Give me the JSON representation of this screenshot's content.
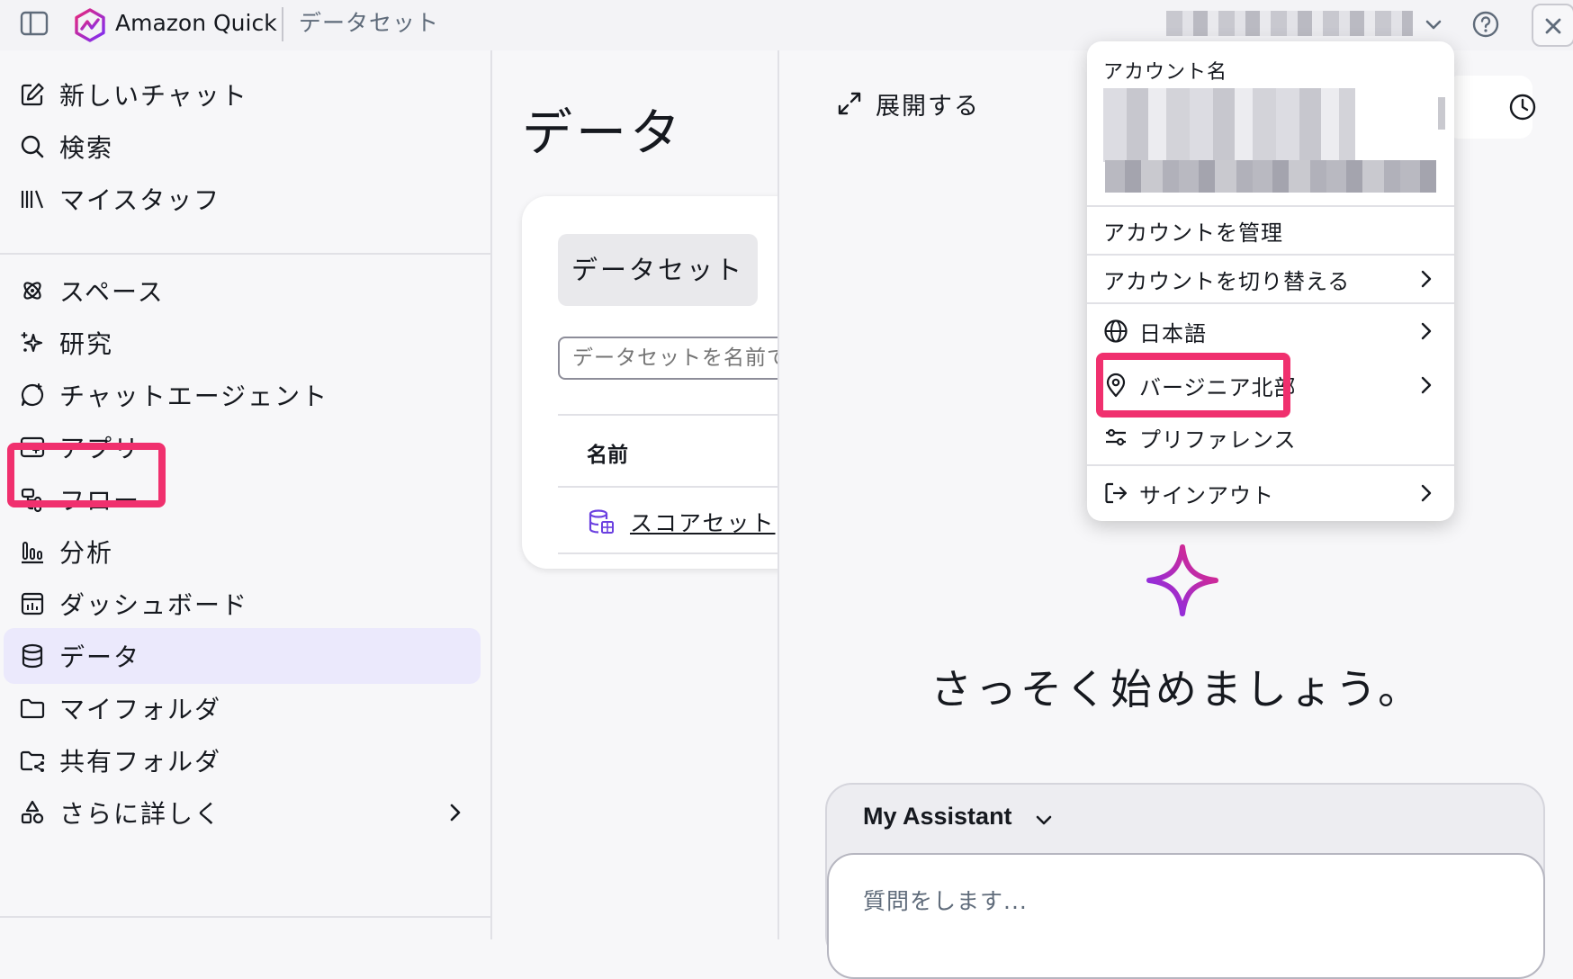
{
  "topbar": {
    "app_name": "Amazon Quick",
    "breadcrumb": "データセット",
    "colors": {
      "brand_gradient": [
        "#e8287a",
        "#7b2ff7"
      ]
    }
  },
  "sidebar": {
    "items": [
      {
        "label": "新しいチャット",
        "icon": "edit-icon"
      },
      {
        "label": "検索",
        "icon": "search-icon"
      },
      {
        "label": "マイスタッフ",
        "icon": "library-icon"
      },
      {
        "label": "スペース",
        "icon": "spaces-icon"
      },
      {
        "label": "研究",
        "icon": "research-sparkle-icon"
      },
      {
        "label": "チャットエージェント",
        "icon": "chat-agent-icon"
      },
      {
        "label": "アプリ",
        "icon": "apps-icon"
      },
      {
        "label": "フロー",
        "icon": "flows-icon"
      },
      {
        "label": "分析",
        "icon": "analysis-icon"
      },
      {
        "label": "ダッシュボード",
        "icon": "dashboard-icon"
      },
      {
        "label": "データ",
        "icon": "database-icon"
      },
      {
        "label": "マイフォルダ",
        "icon": "folder-icon"
      },
      {
        "label": "共有フォルダ",
        "icon": "shared-folder-icon"
      },
      {
        "label": "さらに詳しく",
        "icon": "shapes-icon"
      }
    ],
    "active_item": "データ",
    "highlight_color": "#f0306e",
    "active_bg": "#ebe9fc"
  },
  "data_panel": {
    "title": "データ",
    "tab": "データセット",
    "search_placeholder": "データセットを名前で",
    "column_header": "名前",
    "rows": [
      {
        "name": "スコアセット"
      }
    ]
  },
  "assistant": {
    "expand_label": "展開する",
    "heading": "さっそく始めましょう。",
    "model": "My Assistant",
    "input_placeholder": "質問をします..."
  },
  "account_menu": {
    "section_label": "アカウント名",
    "manage": "アカウントを管理",
    "switch": "アカウントを切り替える",
    "language": "日本語",
    "region": "バージニア北部",
    "preferences": "プリファレンス",
    "sign_out": "サインアウト"
  }
}
